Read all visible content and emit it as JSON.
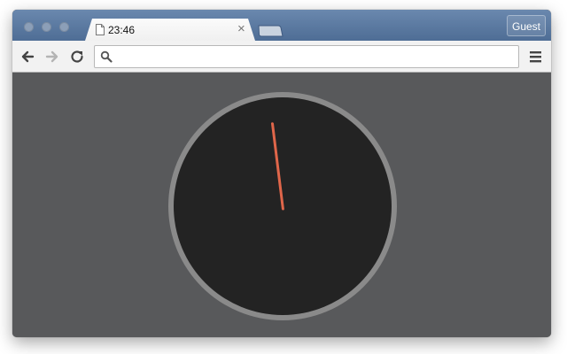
{
  "tab": {
    "title": "23:46",
    "close_glyph": "×",
    "page_icon": "page-icon"
  },
  "titlebar": {
    "guest_label": "Guest"
  },
  "toolbar": {
    "back_icon": "back-arrow-icon",
    "forward_icon": "forward-arrow-icon",
    "reload_icon": "reload-icon",
    "menu_icon": "hamburger-menu-icon"
  },
  "omnibox": {
    "value": "",
    "placeholder": "",
    "search_icon": "search-icon"
  },
  "clock": {
    "hour": 23,
    "minute": 46,
    "face_color": "#232323",
    "ring_color": "#8a8a8a",
    "hand_color": "#e0664a"
  }
}
